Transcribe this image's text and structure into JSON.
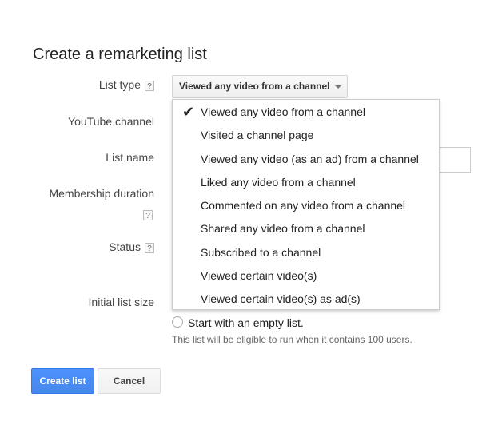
{
  "title": "Create a remarketing list",
  "form": {
    "list_type_label": "List type",
    "youtube_channel_label": "YouTube channel",
    "list_name_label": "List name",
    "membership_duration_label": "Membership duration",
    "status_label": "Status",
    "initial_list_size_label": "Initial list size",
    "help_glyph": "?"
  },
  "list_type": {
    "selected": "Viewed any video from a channel",
    "options": [
      "Viewed any video from a channel",
      "Visited a channel page",
      "Viewed any video (as an ad) from a channel",
      "Liked any video from a channel",
      "Commented on any video from a channel",
      "Shared any video from a channel",
      "Subscribed to a channel",
      "Viewed certain video(s)",
      "Viewed certain video(s) as ad(s)"
    ],
    "check_glyph": "✔"
  },
  "initial_size": {
    "option_label": "Start with an empty list.",
    "hint": "This list will be eligible to run when it contains 100 users."
  },
  "buttons": {
    "create": "Create list",
    "cancel": "Cancel"
  },
  "colors": {
    "primary": "#4d90fe",
    "primary_border": "#3079ed"
  }
}
